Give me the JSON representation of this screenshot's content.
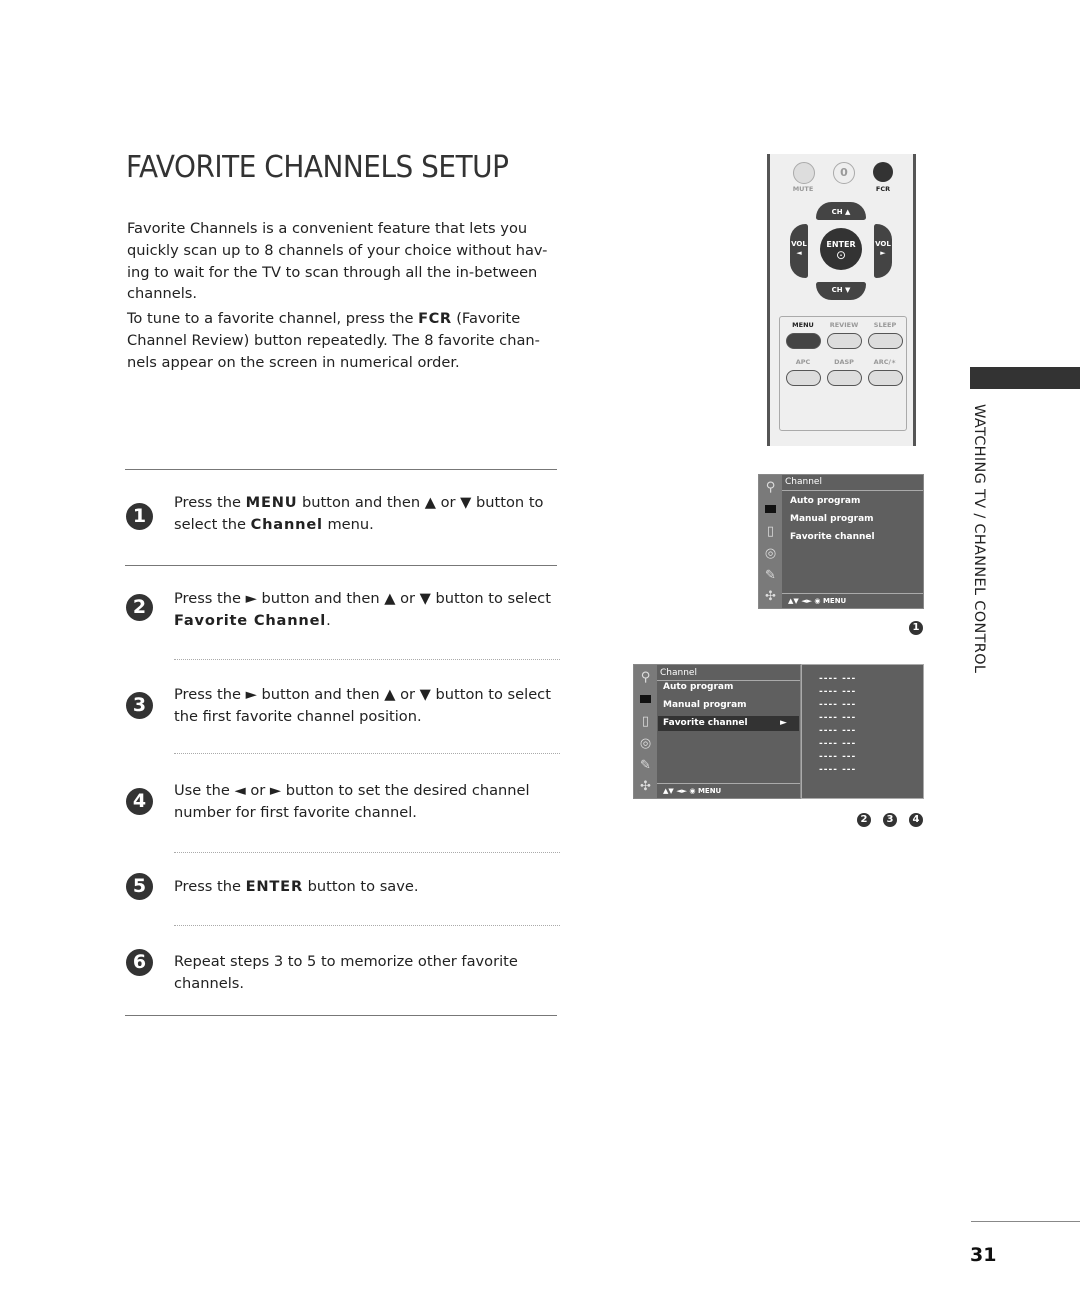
{
  "page": {
    "title": "FAVORITE CHANNELS SETUP",
    "section_label": "WATCHING TV / CHANNEL CONTROL",
    "page_number": "31"
  },
  "intro": {
    "paragraph1": "Favorite Channels is a convenient feature that lets you quickly scan up to 8 channels of your choice without hav- ing to wait for the TV to scan through all the in-between channels.",
    "paragraph2_pre": "To tune to a favorite channel, press the ",
    "paragraph2_bold": "FCR",
    "paragraph2_post": " (Favorite Channel Review) button repeatedly. The 8 favorite chan- nels appear on the screen in numerical order."
  },
  "steps": [
    {
      "num": "1",
      "parts": [
        "Press the ",
        "MENU",
        " button and then ▲ or ▼ button to select the ",
        "Channel",
        " menu."
      ]
    },
    {
      "num": "2",
      "parts": [
        "Press the ► button and then ▲ or ▼ button to select ",
        "Favorite Channel",
        "."
      ]
    },
    {
      "num": "3",
      "text": "Press the ► button and then ▲ or ▼ button to select the first favorite channel position."
    },
    {
      "num": "4",
      "text": "Use the ◄ or ►  button to set the desired channel number for first favorite channel."
    },
    {
      "num": "5",
      "parts": [
        "Press the ",
        "ENTER",
        " button to save."
      ]
    },
    {
      "num": "6",
      "text": "Repeat steps 3 to 5 to memorize other favorite channels."
    }
  ],
  "remote": {
    "top_buttons": [
      {
        "label": "MUTE"
      },
      {
        "label": "0",
        "sublabel": ""
      },
      {
        "label": "FCR"
      }
    ],
    "dpad": {
      "up": "CH ▲",
      "down": "CH ▼",
      "left": "VOL ◄",
      "right": "VOL ►",
      "center": "ENTER",
      "center_symbol": "⊙"
    },
    "row1": [
      "MENU",
      "REVIEW",
      "SLEEP"
    ],
    "row2": [
      "APC",
      "DASP",
      "ARC/✶"
    ],
    "highlighted_button": "MENU"
  },
  "osd1": {
    "title": "Channel",
    "items": [
      "Auto program",
      "Manual program",
      "Favorite channel"
    ],
    "footer": "▲▼  ◄►  ◉  MENU",
    "badge": "1"
  },
  "osd2": {
    "title": "Channel",
    "items": [
      "Auto program",
      "Manual program",
      "Favorite channel"
    ],
    "selected_item": "Favorite channel",
    "selected_arrow": "►",
    "footer": "▲▼  ◄►  ◉  MENU",
    "favorite_slots": [
      "----   ---",
      "----   ---",
      "----   ---",
      "----   ---",
      "----   ---",
      "----   ---",
      "----   ---",
      "----   ---"
    ],
    "badges": [
      "2",
      "3",
      "4"
    ]
  },
  "osd_icons": [
    "antenna-icon",
    "picture-icon",
    "speaker-icon",
    "time-icon",
    "option-icon",
    "lock-icon"
  ]
}
